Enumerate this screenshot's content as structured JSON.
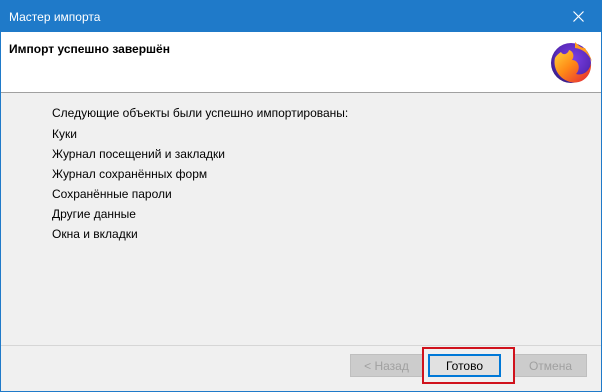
{
  "window": {
    "title": "Мастер импорта",
    "close_icon": "close-icon"
  },
  "header": {
    "title": "Импорт успешно завершён",
    "logo_icon": "firefox-logo-icon"
  },
  "content": {
    "intro": "Следующие объекты были успешно импортированы:",
    "items": [
      "Куки",
      "Журнал посещений и закладки",
      "Журнал сохранённых форм",
      "Сохранённые пароли",
      "Другие данные",
      "Окна и вкладки"
    ]
  },
  "buttons": {
    "back": "< Назад",
    "finish": "Готово",
    "cancel": "Отмена"
  },
  "colors": {
    "titlebar": "#1f7ac9",
    "highlight": "#d0121c",
    "dialog_bg": "#f0f0f0"
  }
}
